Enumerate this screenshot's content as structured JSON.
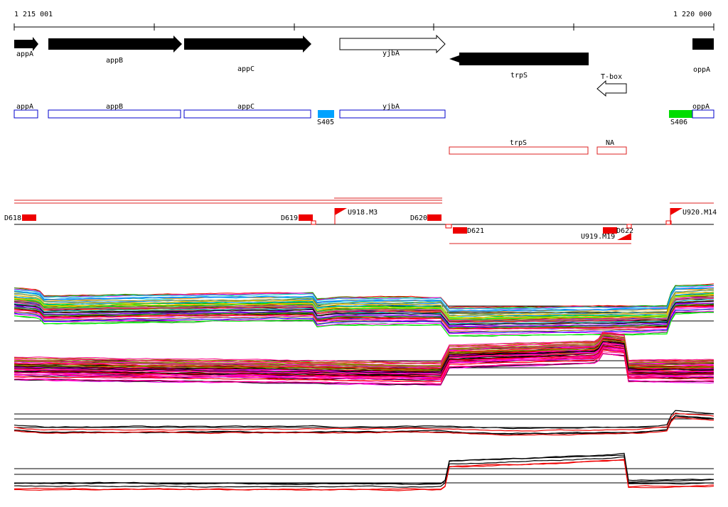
{
  "ruler": {
    "start_label": "1 215 001",
    "end_label": "1 220 000"
  },
  "genes": [
    {
      "id": "appA_top",
      "label": "appA",
      "strand": "forward",
      "fill": "black"
    },
    {
      "id": "appB_top",
      "label": "appB",
      "strand": "forward",
      "fill": "black"
    },
    {
      "id": "appC_top",
      "label": "appC",
      "strand": "forward",
      "fill": "black"
    },
    {
      "id": "yjbA_top",
      "label": "yjbA",
      "strand": "forward",
      "fill": "white"
    },
    {
      "id": "trpS_top",
      "label": "trpS",
      "strand": "reverse",
      "fill": "black"
    },
    {
      "id": "tbox_top",
      "label": "T-box",
      "strand": "reverse",
      "fill": "white"
    },
    {
      "id": "oppA_top",
      "label": "oppA",
      "strand": "forward",
      "fill": "black"
    }
  ],
  "forward_features": [
    {
      "label": "appA"
    },
    {
      "label": "appB"
    },
    {
      "label": "appC"
    },
    {
      "label": "S405"
    },
    {
      "label": "yjbA"
    },
    {
      "label": "S406"
    },
    {
      "label": "oppA"
    }
  ],
  "reverse_features": [
    {
      "label": "trpS"
    },
    {
      "label": "NA"
    }
  ],
  "segments": {
    "forward": [
      "D618",
      "D619",
      "U918.M3",
      "D620",
      "U920.M14"
    ],
    "reverse": [
      "D621",
      "U919.M19",
      "D622"
    ]
  },
  "colors": {
    "gene_black": "#000000",
    "forward_box": "#0000cc",
    "reverse_box": "#dd2222",
    "S405": "#00a2ff",
    "S406": "#00dd00",
    "segment": "#ee0000"
  }
}
